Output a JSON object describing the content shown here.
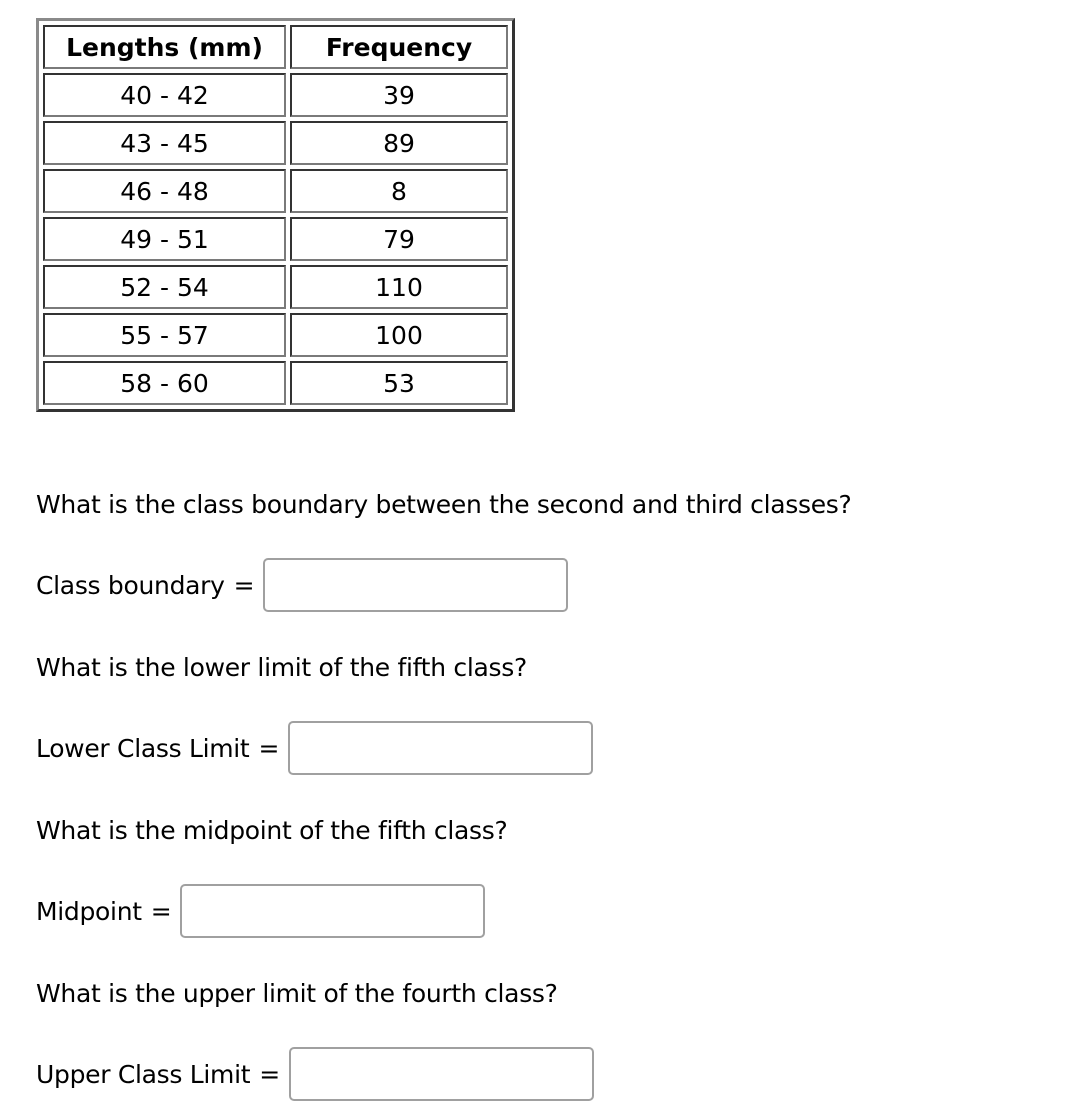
{
  "table": {
    "headers": [
      "Lengths (mm)",
      "Frequency"
    ],
    "rows": [
      {
        "length": "40 - 42",
        "frequency": "39"
      },
      {
        "length": "43 - 45",
        "frequency": "89"
      },
      {
        "length": "46 - 48",
        "frequency": "8"
      },
      {
        "length": "49 - 51",
        "frequency": "79"
      },
      {
        "length": "52 - 54",
        "frequency": "110"
      },
      {
        "length": "55 - 57",
        "frequency": "100"
      },
      {
        "length": "58 - 60",
        "frequency": "53"
      }
    ]
  },
  "questions": [
    {
      "prompt": "What is the class boundary between the second and third classes?",
      "label": "Class boundary",
      "eq": "=",
      "value": ""
    },
    {
      "prompt": "What is the lower limit of the fifth class?",
      "label": "Lower Class Limit",
      "eq": "=",
      "value": ""
    },
    {
      "prompt": "What is the midpoint of the fifth class?",
      "label": "Midpoint",
      "eq": "=",
      "value": ""
    },
    {
      "prompt": "What is the upper limit of the fourth class?",
      "label": "Upper Class Limit",
      "eq": "=",
      "value": ""
    }
  ]
}
